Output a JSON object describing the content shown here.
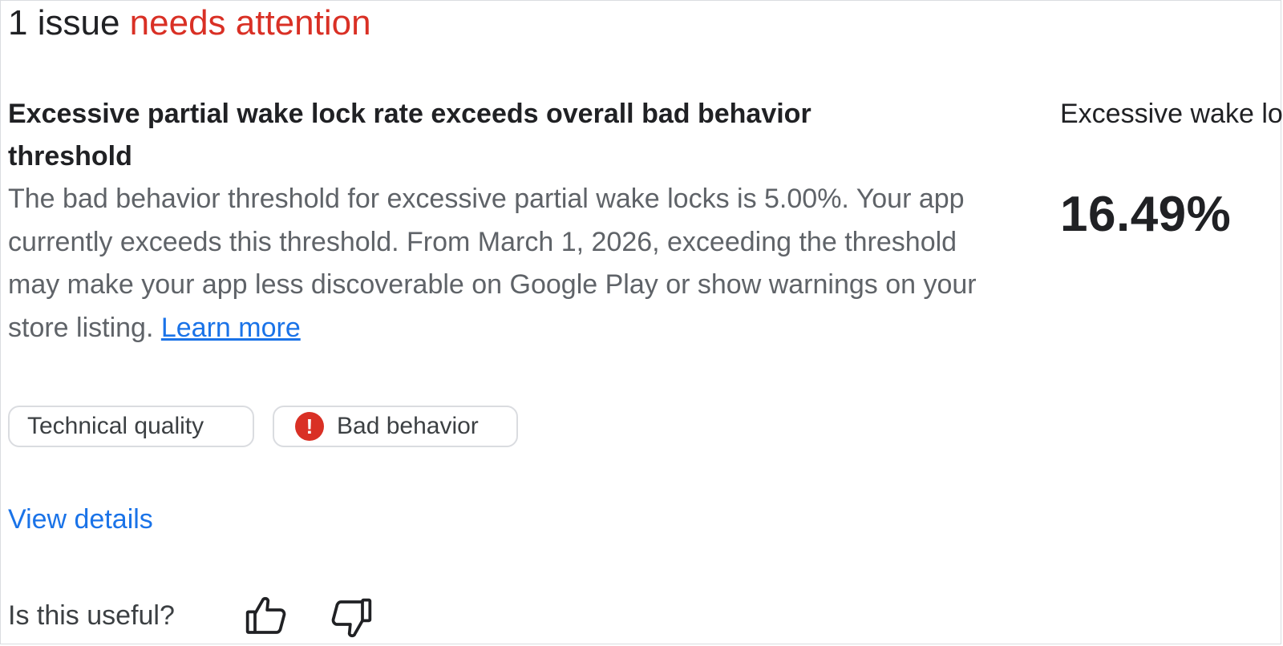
{
  "summary": {
    "count_text": "1 issue",
    "status_text": "needs attention"
  },
  "issue": {
    "title": "Excessive partial wake lock rate exceeds overall bad behavior threshold",
    "description": "The bad behavior threshold for excessive partial wake locks is 5.00%. Your app currently exceeds this threshold. From March 1, 2026, exceeding the threshold may make your app less discoverable on Google Play or show warnings on your store listing.",
    "learn_more_label": "Learn more"
  },
  "metric": {
    "label": "Excessive wake lock rate",
    "value": "16.49%"
  },
  "chips": [
    {
      "label": "Technical quality",
      "icon": ""
    },
    {
      "label": "Bad behavior",
      "icon": "alert-icon",
      "icon_glyph": "!"
    }
  ],
  "view_details_label": "View details",
  "feedback": {
    "question": "Is this useful?",
    "thumbs_up_icon": "thumb-up-icon",
    "thumbs_down_icon": "thumb-down-icon"
  },
  "colors": {
    "attention": "#d93025",
    "link": "#1a73e8",
    "chip_border": "#dadce0",
    "secondary_text": "#5f6368"
  }
}
